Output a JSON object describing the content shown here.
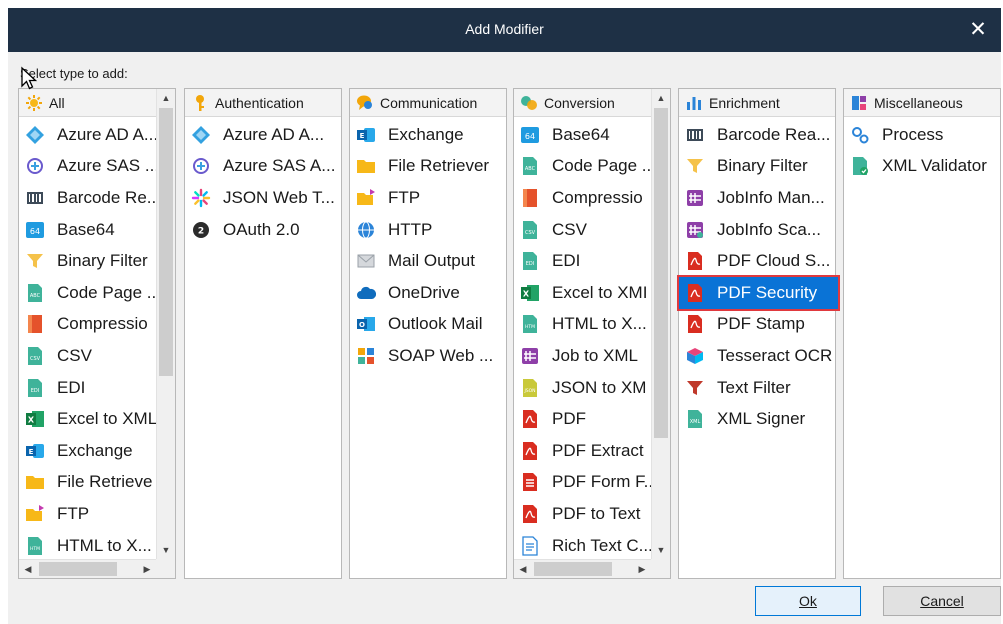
{
  "window": {
    "title": "Add Modifier",
    "close_glyph": "✕"
  },
  "prompt": "Select type to add:",
  "columns": {
    "all": {
      "header": "All",
      "items": [
        "Azure AD A...",
        "Azure SAS ...",
        "Barcode Re...",
        "Base64",
        "Binary Filter",
        "Code Page ...",
        "Compressio",
        "CSV",
        "EDI",
        "Excel to XML",
        "Exchange",
        "File Retrieve",
        "FTP",
        "HTML to X..."
      ]
    },
    "authentication": {
      "header": "Authentication",
      "items": [
        "Azure AD A...",
        "Azure SAS A...",
        "JSON Web T...",
        "OAuth 2.0"
      ]
    },
    "communication": {
      "header": "Communication",
      "items": [
        "Exchange",
        "File Retriever",
        "FTP",
        "HTTP",
        "Mail Output",
        "OneDrive",
        "Outlook Mail",
        "SOAP Web ..."
      ]
    },
    "conversion": {
      "header": "Conversion",
      "items": [
        "Base64",
        "Code Page ...",
        "Compressio",
        "CSV",
        "EDI",
        "Excel to XMI",
        "HTML to X...",
        "Job to XML",
        "JSON to XM",
        "PDF",
        "PDF Extract",
        "PDF Form F...",
        "PDF to Text",
        "Rich Text C..."
      ]
    },
    "enrichment": {
      "header": "Enrichment",
      "items": [
        "Barcode Rea...",
        "Binary Filter",
        "JobInfo Man...",
        "JobInfo Sca...",
        "PDF Cloud S...",
        "PDF Security",
        "PDF Stamp",
        "Tesseract OCR",
        "Text Filter",
        "XML Signer"
      ],
      "selected": "PDF Security"
    },
    "miscellaneous": {
      "header": "Miscellaneous",
      "items": [
        "Process",
        "XML Validator"
      ]
    }
  },
  "buttons": {
    "ok": "Ok",
    "cancel": "Cancel"
  },
  "colors": {
    "titlebar": "#1e3045",
    "selection": "#0a73d6",
    "selection_outline": "#e0393e",
    "dialog_bg": "#f0f0f0"
  }
}
